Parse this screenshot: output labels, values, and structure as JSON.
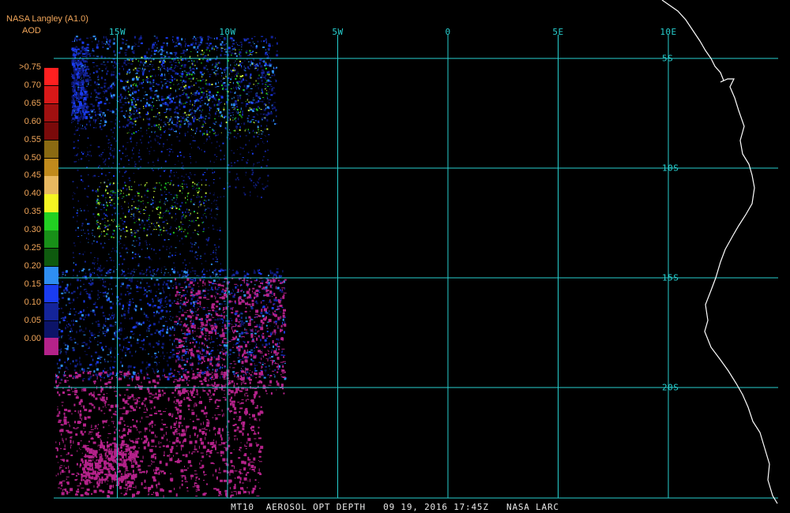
{
  "header": {
    "source": "NASA Langley (A1.0)",
    "product": "AOD"
  },
  "footer": {
    "caption": "MT10  AEROSOL OPT DEPTH   09 19, 2016 17:45Z   NASA LARC"
  },
  "grid": {
    "longitudes": [
      {
        "label": "15W",
        "value": -15
      },
      {
        "label": "10W",
        "value": -10
      },
      {
        "label": "5W",
        "value": -5
      },
      {
        "label": "0",
        "value": 0
      },
      {
        "label": "5E",
        "value": 5
      },
      {
        "label": "10E",
        "value": 10
      }
    ],
    "latitudes": [
      {
        "label": "5S",
        "value": -5
      },
      {
        "label": "10S",
        "value": -10
      },
      {
        "label": "15S",
        "value": -15
      },
      {
        "label": "20S",
        "value": -20
      }
    ],
    "line_color": "#27d0d0"
  },
  "legend": {
    "title": "AOD",
    "entries": [
      {
        "label": ">0.75",
        "color": ""
      },
      {
        "label": "0.70",
        "color": "#ff2020"
      },
      {
        "label": "0.65",
        "color": "#d81818"
      },
      {
        "label": "0.60",
        "color": "#a01010"
      },
      {
        "label": "0.55",
        "color": "#7a0a0a"
      },
      {
        "label": "0.50",
        "color": "#8a6a12"
      },
      {
        "label": "0.45",
        "color": "#c08a1c"
      },
      {
        "label": "0.40",
        "color": "#e8b860"
      },
      {
        "label": "0.35",
        "color": "#f5f522"
      },
      {
        "label": "0.30",
        "color": "#22d022"
      },
      {
        "label": "0.25",
        "color": "#189018"
      },
      {
        "label": "0.20",
        "color": "#0e5a0e"
      },
      {
        "label": "0.15",
        "color": "#2e8ef2"
      },
      {
        "label": "0.10",
        "color": "#1a3cf0"
      },
      {
        "label": "0.05",
        "color": "#14249a"
      },
      {
        "label": "0.00",
        "color": "#0c1468"
      }
    ],
    "bottom_color": "#b4228a"
  },
  "aod_colors": {
    "very_low": "#b4228a",
    "low_dark": "#0c1468",
    "low": "#14249a",
    "mid_low": "#1a3cf0",
    "light_blue": "#2e8ef2",
    "green": "#22d022",
    "yellow_green": "#c8f03c"
  },
  "coastline_color": "#ffffff"
}
